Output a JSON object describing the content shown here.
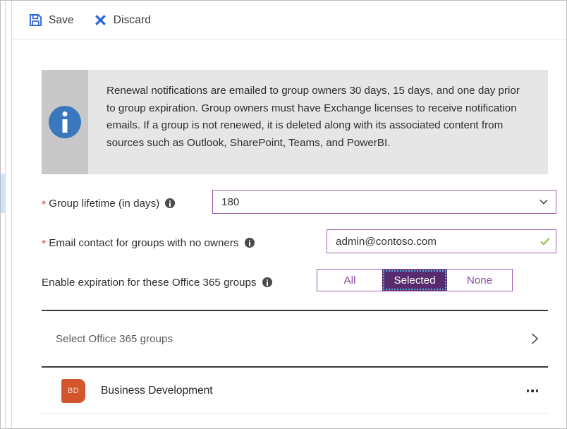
{
  "commandbar": {
    "save": {
      "label": "Save",
      "icon": "save-floppy-icon",
      "color": "#2b64d9"
    },
    "discard": {
      "label": "Discard",
      "icon": "close-x-icon",
      "color": "#2b64d9"
    }
  },
  "banner": {
    "icon": "info-circle-icon",
    "icon_color": "#3a77bd",
    "background": "#e6e6e6",
    "text": "Renewal notifications are emailed to group owners 30 days, 15 days, and one day prior to group expiration. Group owners must have Exchange licenses to receive notification emails. If a group is not renewed, it is deleted along with its associated content from sources such as Outlook, SharePoint, Teams, and PowerBI."
  },
  "form": {
    "group_lifetime": {
      "required_marker": "*",
      "label": "Group lifetime (in days)",
      "tooltip_icon": "info-tooltip-icon",
      "value": "180",
      "chevron": "chevron-down-icon"
    },
    "email_contact": {
      "required_marker": "*",
      "label": "Email contact for groups with no owners",
      "tooltip_icon": "info-tooltip-icon",
      "value": "admin@contoso.com",
      "placeholder": "",
      "validation_icon": "checkmark-valid-icon",
      "validation_color": "#8cc63e"
    },
    "enable_expiration": {
      "label": "Enable expiration for these Office 365 groups",
      "tooltip_icon": "info-tooltip-icon",
      "options": [
        "All",
        "Selected",
        "None"
      ],
      "selected": "Selected",
      "accent": "#582b6e",
      "border": "#9b5fad"
    }
  },
  "group_picker": {
    "label": "Select Office 365 groups",
    "chevron": "chevron-right-icon"
  },
  "group_list": [
    {
      "initials": "BD",
      "name": "Business Development",
      "avatar_color": "#d2552c",
      "overflow_icon": "more-ellipsis-icon"
    }
  ]
}
